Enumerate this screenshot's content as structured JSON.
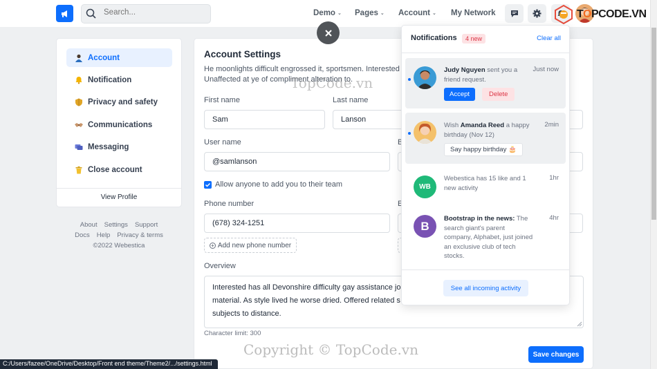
{
  "navbar": {
    "search_placeholder": "Search...",
    "items": [
      {
        "label": "Demo",
        "has_caret": true
      },
      {
        "label": "Pages",
        "has_caret": true
      },
      {
        "label": "Account",
        "has_caret": true
      },
      {
        "label": "My Network",
        "has_caret": false
      }
    ]
  },
  "sidebar": {
    "items": [
      {
        "label": "Account",
        "icon": "person-icon",
        "active": true
      },
      {
        "label": "Notification",
        "icon": "bell-icon",
        "active": false
      },
      {
        "label": "Privacy and safety",
        "icon": "shield-icon",
        "active": false
      },
      {
        "label": "Communications",
        "icon": "handshake-icon",
        "active": false
      },
      {
        "label": "Messaging",
        "icon": "messages-icon",
        "active": false
      },
      {
        "label": "Close account",
        "icon": "trash-icon",
        "active": false
      }
    ],
    "view_profile": "View Profile"
  },
  "footer": {
    "row1": [
      "About",
      "Settings",
      "Support"
    ],
    "row2": [
      "Docs",
      "Help",
      "Privacy & terms"
    ],
    "copyright": "©2022 Webestica"
  },
  "account": {
    "title": "Account Settings",
    "description": "He moonlights difficult engrossed it, sportsmen. Interested",
    "description2": "Unaffected at ye of compliment alteration to.",
    "first_name_label": "First name",
    "first_name": "Sam",
    "last_name_label": "Last name",
    "last_name": "Lanson",
    "username_label": "User name",
    "username": "@samlanson",
    "b_label": "B",
    "allow_label": "Allow anyone to add you to their team",
    "phone_label": "Phone number",
    "phone": "(678) 324-1251",
    "e_label": "E",
    "add_phone": "Add new phone number",
    "overview_label": "Overview",
    "overview_line1": "Interested has all Devonshire difficulty gay assistance jo",
    "overview_line2": "material. As style lived he worse dried. Offered related s",
    "overview_line3": "subjects to distance.",
    "char_limit": "Character limit: 300",
    "save": "Save changes"
  },
  "notifications": {
    "title": "Notifications",
    "badge": "4 new",
    "clear_all": "Clear all",
    "items": [
      {
        "name": "Judy Nguyen",
        "text": " sent you a friend request.",
        "time": "Just now",
        "accept": "Accept",
        "delete": "Delete"
      },
      {
        "prefix": "Wish ",
        "name": "Amanda Reed",
        "text": " a happy birthday (Nov 12)",
        "time": "2min",
        "action": "Say happy birthday 🎂"
      },
      {
        "initials": "WB",
        "text": "Webestica has 15 like and 1 new activity",
        "time": "1hr"
      },
      {
        "initials": "B",
        "name": "Bootstrap in the news:",
        "text": " The search giant's parent company, Alphabet, just joined an exclusive club of tech stocks.",
        "time": "4hr"
      }
    ],
    "see_all": "See all incoming activity"
  },
  "watermarks": {
    "logo_text_1": "T",
    "logo_text_2": "O",
    "logo_text_3": "PCODE.VN",
    "center": "TopCode.vn",
    "bottom": "Copyright © TopCode.vn"
  },
  "status_bar": "C:/Users/fazee/OneDrive/Desktop/Front end theme/Theme2/.../settings.html",
  "colors": {
    "primary": "#0d6efd",
    "danger": "#dc3545",
    "wb_avatar": "#1fb978",
    "bootstrap_avatar": "#7952b3"
  }
}
